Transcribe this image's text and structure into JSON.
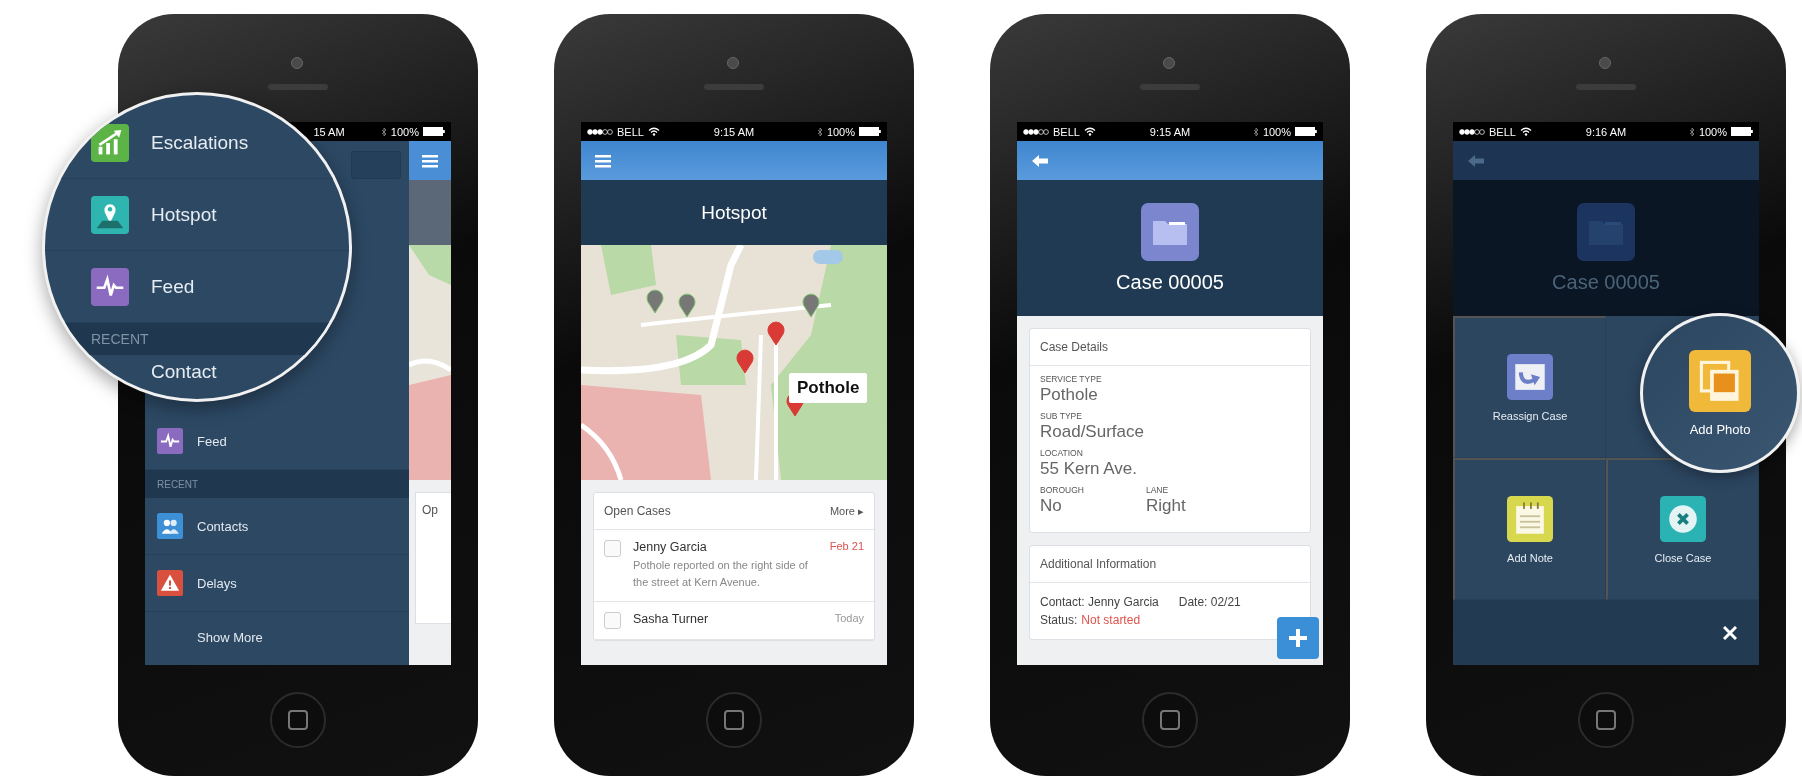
{
  "phones": [
    {
      "kind": "menu",
      "status_bar": {
        "time": "15 AM",
        "battery": "100%"
      },
      "magnifier": {
        "items": [
          {
            "label": "Escalations",
            "kind": "escalations",
            "color": "#5cb446"
          },
          {
            "label": "Hotspot",
            "kind": "hotspot",
            "color": "#2fb5b0"
          },
          {
            "label": "Feed",
            "kind": "feed",
            "color": "#8b6bc0"
          }
        ],
        "section": "RECENT",
        "cut_item": "Contact"
      },
      "menu": {
        "items": [
          {
            "label": "Feed",
            "kind": "feed",
            "color": "#8b6bc0"
          }
        ],
        "section": "RECENT",
        "recent": [
          {
            "label": "Contacts",
            "kind": "contacts",
            "color": "#3d8fd6"
          },
          {
            "label": "Delays",
            "kind": "delays",
            "color": "#d9503f"
          }
        ],
        "show_more": "Show More"
      },
      "background_card": "Op"
    },
    {
      "kind": "map",
      "status_bar": {
        "carrier": "BELL",
        "time": "9:15 AM",
        "battery": "100%"
      },
      "title": "Hotspot",
      "map_callout": "Pothole",
      "list": {
        "title": "Open Cases",
        "more": "More ▸",
        "rows": [
          {
            "name": "Jenny Garcia",
            "date": "Feb 21",
            "overdue": true,
            "checked": false,
            "description": "Pothole reported on the right side of the street at Kern Avenue."
          },
          {
            "name": "Sasha Turner",
            "date": "Today",
            "overdue": false,
            "checked": false
          }
        ]
      }
    },
    {
      "kind": "case",
      "status_bar": {
        "carrier": "BELL",
        "time": "9:15 AM",
        "battery": "100%"
      },
      "title": "Case 00005",
      "details": {
        "title": "Case Details",
        "fields": [
          {
            "label": "SERVICE TYPE",
            "value": "Pothole"
          },
          {
            "label": "SUB TYPE",
            "value": "Road/Surface"
          },
          {
            "label": "LOCATION",
            "value": "55 Kern Ave."
          }
        ],
        "pair": [
          {
            "label": "BOROUGH",
            "value": "No"
          },
          {
            "label": "LANE",
            "value": "Right"
          }
        ]
      },
      "additional": {
        "title": "Additional Information",
        "contact": "Contact: Jenny Garcia",
        "date": "Date: 02/21",
        "status_label": "Status:",
        "status_value": "Not started"
      }
    },
    {
      "kind": "actions",
      "status_bar": {
        "carrier": "BELL",
        "time": "9:16 AM",
        "battery": "100%"
      },
      "title": "Case 00005",
      "actions": [
        {
          "label": "Reassign Case",
          "kind": "reassign",
          "color": "#6d7fc8",
          "magnified": false
        },
        {
          "label": "Add Photo",
          "kind": "photo",
          "color": "#f0b93a",
          "magnified": true
        },
        {
          "label": "Add Note",
          "kind": "note",
          "color": "#d7d84e",
          "magnified": false
        },
        {
          "label": "Close Case",
          "kind": "close",
          "color": "#2bb3b3",
          "magnified": false
        }
      ]
    }
  ]
}
